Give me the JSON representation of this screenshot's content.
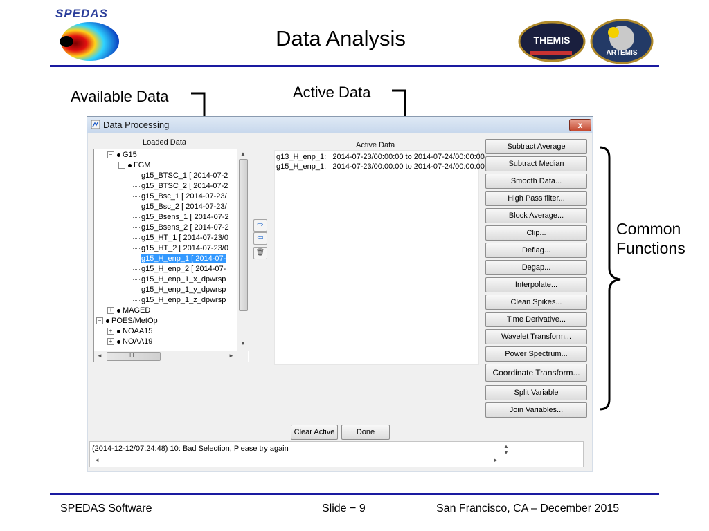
{
  "slide": {
    "title": "Data Analysis",
    "logo_text": "SPEDAS",
    "badge_left": "THEMIS",
    "badge_right": "ARTEMIS"
  },
  "callouts": {
    "available": "Available Data",
    "active": "Active Data",
    "common": "Common",
    "functions": "Functions"
  },
  "window": {
    "title": "Data Processing",
    "close_label": "x",
    "loaded_label": "Loaded Data",
    "active_label": "Active Data"
  },
  "tree": [
    {
      "label": "G15",
      "level": 1,
      "expander": "−"
    },
    {
      "label": "FGM",
      "level": 2,
      "expander": "−"
    },
    {
      "label": "g15_BTSC_1 [ 2014-07-2",
      "level": 3
    },
    {
      "label": "g15_BTSC_2 [ 2014-07-2",
      "level": 3
    },
    {
      "label": "g15_Bsc_1 [ 2014-07-23/",
      "level": 3
    },
    {
      "label": "g15_Bsc_2 [ 2014-07-23/",
      "level": 3
    },
    {
      "label": "g15_Bsens_1 [ 2014-07-2",
      "level": 3
    },
    {
      "label": "g15_Bsens_2 [ 2014-07-2",
      "level": 3
    },
    {
      "label": "g15_HT_1 [ 2014-07-23/0",
      "level": 3
    },
    {
      "label": "g15_HT_2 [ 2014-07-23/0",
      "level": 3
    },
    {
      "label": "g15_H_enp_1 [ 2014-07-",
      "level": 3,
      "selected": true
    },
    {
      "label": "g15_H_enp_2 [ 2014-07-",
      "level": 3
    },
    {
      "label": "g15_H_enp_1_x_dpwrsp",
      "level": 3
    },
    {
      "label": "g15_H_enp_1_y_dpwrsp",
      "level": 3
    },
    {
      "label": "g15_H_enp_1_z_dpwrsp",
      "level": 3
    },
    {
      "label": "MAGED",
      "level": 1,
      "expander": "+"
    },
    {
      "label": "POES/MetOp",
      "level": 0,
      "expander": "−"
    },
    {
      "label": "NOAA15",
      "level": 1,
      "expander": "+"
    },
    {
      "label": "NOAA19",
      "level": 1,
      "expander": "+"
    }
  ],
  "scroll": {
    "up": "▲",
    "down": "▼",
    "left": "◄",
    "right": "►",
    "grip": "III"
  },
  "transfer_buttons": {
    "add": "⇨",
    "remove": "⇦",
    "delete": "🗑"
  },
  "active_data": [
    "g13_H_enp_1:   2014-07-23/00:00:00 to 2014-07-24/00:00:00",
    "g15_H_enp_1:   2014-07-23/00:00:00 to 2014-07-24/00:00:00"
  ],
  "functions": [
    "Subtract Average",
    "Subtract Median",
    "Smooth Data...",
    "High Pass filter...",
    "Block Average...",
    "Clip...",
    "Deflag...",
    "Degap...",
    "Interpolate...",
    "Clean Spikes...",
    "Time Derivative...",
    "Wavelet Transform...",
    "Power Spectrum...",
    "Coordinate Transform...",
    "Split Variable",
    "Join Variables..."
  ],
  "bottom": {
    "clear_active": "Clear Active",
    "done": "Done",
    "status": "(2014-12-12/07:24:48) 10: Bad Selection, Please try again"
  },
  "footer": {
    "left": "SPEDAS Software",
    "center": "Slide − 9",
    "right": "San Francisco, CA – December 2015"
  }
}
